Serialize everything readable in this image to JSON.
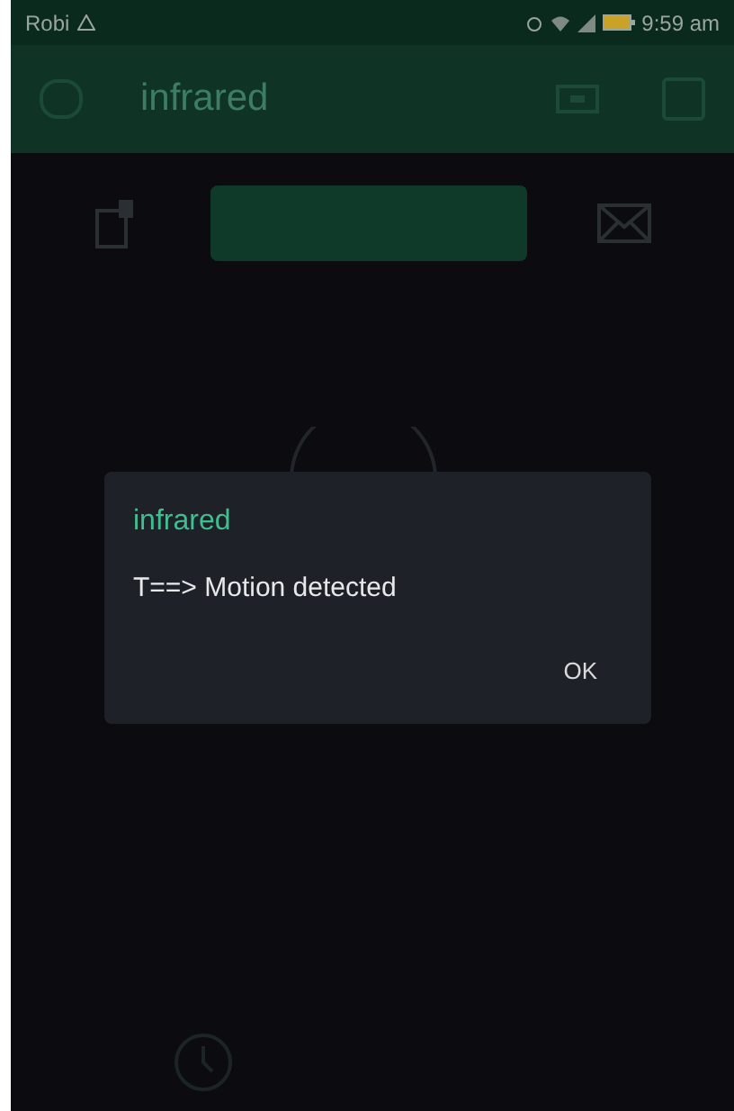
{
  "status_bar": {
    "carrier": "Robi",
    "time": "9:59 am"
  },
  "app_bar": {
    "title": "infrared"
  },
  "dialog": {
    "title": "infrared",
    "message": "T==> Motion detected",
    "button": "OK"
  }
}
